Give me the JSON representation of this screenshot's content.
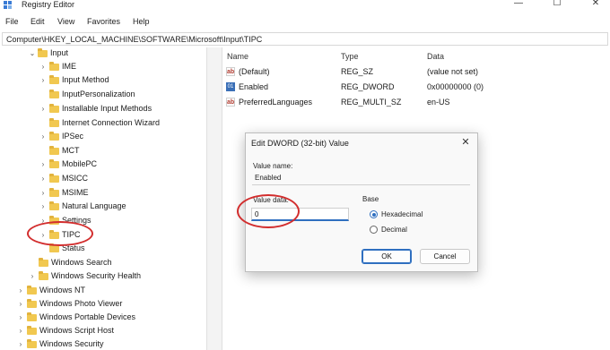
{
  "window": {
    "title": "Registry Editor",
    "controls": [
      "—",
      "☐",
      "✕"
    ]
  },
  "menu": [
    "File",
    "Edit",
    "View",
    "Favorites",
    "Help"
  ],
  "address": "Computer\\HKEY_LOCAL_MACHINE\\SOFTWARE\\Microsoft\\Input\\TIPC",
  "tree": {
    "items": [
      {
        "label": "Input",
        "expanded": true
      },
      {
        "label": "IME",
        "expanded": false
      },
      {
        "label": "Input Method",
        "expanded": false
      },
      {
        "label": "InputPersonalization",
        "expanded": null
      },
      {
        "label": "Installable Input Methods",
        "expanded": false
      },
      {
        "label": "Internet Connection Wizard",
        "expanded": null
      },
      {
        "label": "IPSec",
        "expanded": false
      },
      {
        "label": "MCT",
        "expanded": null
      },
      {
        "label": "MobilePC",
        "expanded": false
      },
      {
        "label": "MSICC",
        "expanded": false
      },
      {
        "label": "MSIME",
        "expanded": false
      },
      {
        "label": "Natural Language",
        "expanded": false
      },
      {
        "label": "Settings",
        "expanded": false
      },
      {
        "label": "TIPC",
        "expanded": false,
        "selected": true
      },
      {
        "label": "Status",
        "expanded": null
      },
      {
        "label": "Windows Search",
        "expanded": null
      },
      {
        "label": "Windows Security Health",
        "expanded": false
      },
      {
        "label": "Windows NT",
        "expanded": false
      },
      {
        "label": "Windows Photo Viewer",
        "expanded": false
      },
      {
        "label": "Windows Portable Devices",
        "expanded": false
      },
      {
        "label": "Windows Script Host",
        "expanded": false
      },
      {
        "label": "Windows Security",
        "expanded": false
      }
    ]
  },
  "list": {
    "columns": [
      "Name",
      "Type",
      "Data"
    ],
    "rows": [
      {
        "name": "(Default)",
        "type": "REG_SZ",
        "data": "(value not set)",
        "icon": "string-value-icon"
      },
      {
        "name": "Enabled",
        "type": "REG_DWORD",
        "data": "0x00000000 (0)",
        "icon": "dword-value-icon"
      },
      {
        "name": "PreferredLanguages",
        "type": "REG_MULTI_SZ",
        "data": "en-US",
        "icon": "string-value-icon"
      }
    ]
  },
  "dialog": {
    "title": "Edit DWORD (32-bit) Value",
    "close": "✕",
    "value_name_label": "Value name:",
    "value_name": "Enabled",
    "value_data_label": "Value data:",
    "value_data": "0",
    "base_label": "Base",
    "base_options": [
      {
        "label": "Hexadecimal",
        "selected": true
      },
      {
        "label": "Decimal",
        "selected": false
      }
    ],
    "ok_label": "OK",
    "cancel_label": "Cancel"
  },
  "colors": {
    "annotation": "#d22d2d",
    "accent": "#2f6fc0",
    "folder": "#f1c850"
  }
}
